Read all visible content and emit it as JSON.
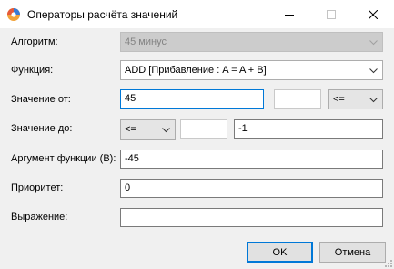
{
  "window": {
    "title": "Операторы расчёта значений",
    "icon": "app-swirl-icon"
  },
  "form": {
    "algorithm": {
      "label": "Алгоритм:",
      "value": "45 минус",
      "enabled": false
    },
    "function": {
      "label": "Функция:",
      "value": "ADD [Прибавление : A = A + B]"
    },
    "value_from": {
      "label": "Значение от:",
      "value": "45",
      "extra_value": "",
      "operator": "<="
    },
    "value_to": {
      "label": "Значение до:",
      "operator": "<=",
      "extra_value": "",
      "value": "-1"
    },
    "argument": {
      "label": "Аргумент функции (B):",
      "value": "-45"
    },
    "priority": {
      "label": "Приоритет:",
      "value": "0"
    },
    "expression": {
      "label": "Выражение:",
      "value": ""
    }
  },
  "buttons": {
    "ok": "OK",
    "cancel": "Отмена"
  },
  "colors": {
    "accent": "#0078d7",
    "client_bg": "#f0f0f0",
    "disabled_bg": "#cccccc"
  }
}
